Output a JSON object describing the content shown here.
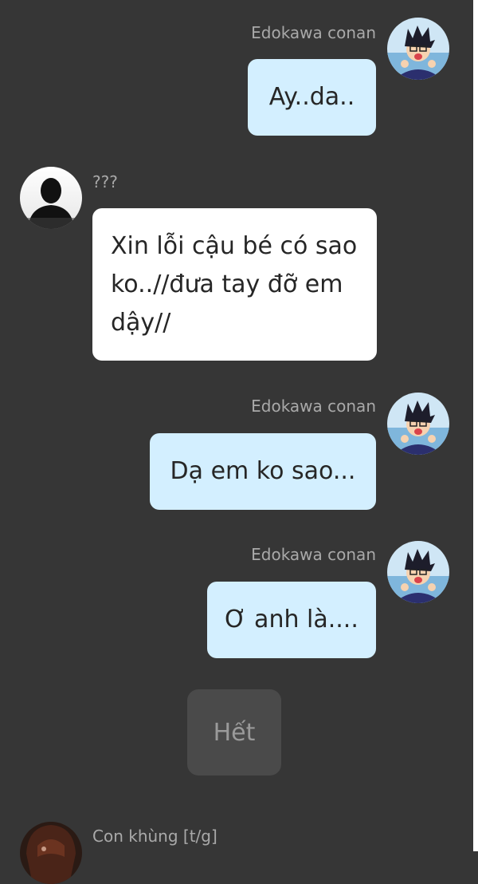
{
  "messages": [
    {
      "side": "right",
      "sender": "Edokawa conan",
      "text": "Ay..da.."
    },
    {
      "side": "left",
      "sender": "???",
      "text": "Xin lỗi cậu bé có sao ko..//đưa tay đỡ em dậy//"
    },
    {
      "side": "right",
      "sender": "Edokawa conan",
      "text": "Dạ em ko sao..."
    },
    {
      "side": "right",
      "sender": "Edokawa conan",
      "text": "Ơ anh là...."
    }
  ],
  "end_label": "Hết",
  "next": {
    "sender": "Con khùng [t/g]"
  },
  "colors": {
    "background": "#363636",
    "own_bubble": "#d3efff",
    "other_bubble": "#ffffff",
    "name_text": "#a9a9a9",
    "end_chip": "#4a4a4a"
  },
  "icons": {
    "own_avatar": "anime-boy-avatar-icon",
    "other_avatar": "silhouette-avatar-icon",
    "next_avatar": "anime-girl-avatar-icon"
  }
}
